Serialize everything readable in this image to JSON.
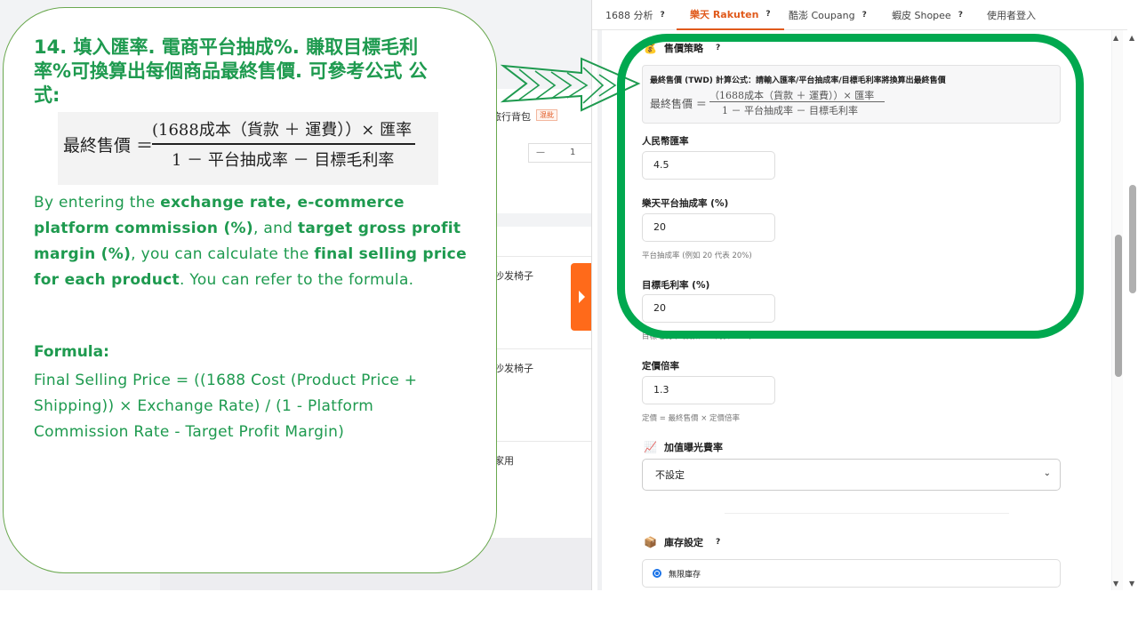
{
  "background": {
    "item1": "旅行背包",
    "tag": "混批",
    "qty_minus": "—",
    "qty_value": "1",
    "item2": "沙发椅子",
    "item3": "沙发椅子",
    "item4": "家用"
  },
  "tabs": [
    {
      "label": "1688 分析",
      "help": "?"
    },
    {
      "label": "樂天 Rakuten",
      "help": "?"
    },
    {
      "label": "酷澎 Coupang",
      "help": "?"
    },
    {
      "label": "蝦皮 Shopee",
      "help": "?"
    },
    {
      "label": "使用者登入"
    }
  ],
  "pricing": {
    "icon": "money-bag-icon",
    "title": "售價策略",
    "help": "?",
    "formula_heading": "最終售價 (TWD) 計算公式：請輸入匯率/平台抽成率/目標毛利率將換算出最終售價",
    "formula_lhs": "最終售價 ＝",
    "formula_num": "（1688成本（貨款 ＋ 運費））× 匯率",
    "formula_den": "1 － 平台抽成率 － 目標毛利率"
  },
  "fields": {
    "exchange_label": "人民幣匯率",
    "exchange_value": "4.5",
    "commission_label": "樂天平台抽成率 (%)",
    "commission_value": "20",
    "commission_hint": "平台抽成率 (例如 20 代表 20%)",
    "margin_label": "目標毛利率 (%)",
    "margin_value": "20",
    "margin_hint": "目標毛利率 (例如 20 代表 20%)",
    "markup_label": "定價倍率",
    "markup_value": "1.3",
    "markup_hint": "定價 = 最終售價 × 定價倍率"
  },
  "exposure": {
    "icon": "chart-up-icon",
    "title": "加值曝光費率",
    "selected": "不設定"
  },
  "inventory": {
    "icon": "box-icon",
    "title": "庫存設定",
    "help": "?",
    "option": "無限庫存"
  },
  "annotation": {
    "title": "14. 填入匯率. 電商平台抽成%. 賺取目標毛利率%可換算出每個商品最終售價. 可參考公式 公式:",
    "formula_lhs": "最終售價 ＝",
    "formula_num": "(1688成本（貨款 ＋ 運費））× 匯率",
    "formula_den": "1 － 平台抽成率 － 目標毛利率",
    "p1": "By entering the ",
    "p1b": "exchange rate, e-commerce platform commission (%)",
    "p2": ", and ",
    "p2b": "target gross profit margin (%)",
    "p3": ", you can calculate the ",
    "p3b": "final selling price for each product",
    "p4": ". You can refer to the formula.",
    "formula_heading": "Formula:",
    "formula_text": "Final Selling Price = ((1688 Cost (Product Price + Shipping)) × Exchange Rate) / (1 - Platform Commission Rate - Target Profit Margin)"
  },
  "colors": {
    "annotation_green": "#1e9a4f",
    "highlight_green": "#00a84f",
    "active_tab": "#e05a1c",
    "orange_tab": "#ff6a1a"
  }
}
